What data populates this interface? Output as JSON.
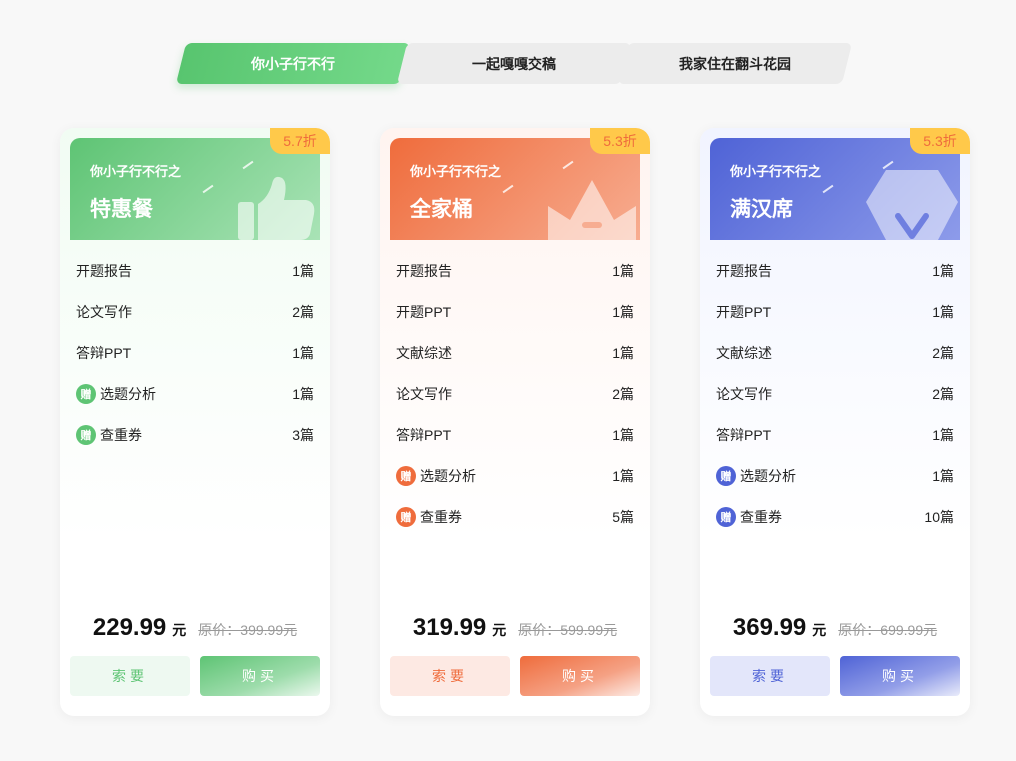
{
  "tabs": [
    {
      "label": "你小子行不行",
      "active": true
    },
    {
      "label": "一起嘎嘎交稿",
      "active": false
    },
    {
      "label": "我家住在翻斗花园",
      "active": false
    }
  ],
  "accents": {
    "green": "#5ec474",
    "orange": "#ef6c3c",
    "blue": "#4f63d6",
    "discount_badge": "#ffc94a"
  },
  "gift_label": "赠",
  "cards": [
    {
      "theme": "green",
      "discount": "5.7折",
      "subtitle": "你小子行不行之",
      "title": "特惠餐",
      "icon": "thumbs-up-icon",
      "items": [
        {
          "name": "开题报告",
          "count": "1篇",
          "gift": false
        },
        {
          "name": "论文写作",
          "count": "2篇",
          "gift": false
        },
        {
          "name": "答辩PPT",
          "count": "1篇",
          "gift": false
        },
        {
          "name": "选题分析",
          "count": "1篇",
          "gift": true
        },
        {
          "name": "查重券",
          "count": "3篇",
          "gift": true
        }
      ],
      "price": "229.99",
      "unit": "元",
      "original_price": "原价：399.99元",
      "ask_label": "索要",
      "buy_label": "购买"
    },
    {
      "theme": "orange",
      "discount": "5.3折",
      "subtitle": "你小子行不行之",
      "title": "全家桶",
      "icon": "crown-icon",
      "items": [
        {
          "name": "开题报告",
          "count": "1篇",
          "gift": false
        },
        {
          "name": "开题PPT",
          "count": "1篇",
          "gift": false
        },
        {
          "name": "文献综述",
          "count": "1篇",
          "gift": false
        },
        {
          "name": "论文写作",
          "count": "2篇",
          "gift": false
        },
        {
          "name": "答辩PPT",
          "count": "1篇",
          "gift": false
        },
        {
          "name": "选题分析",
          "count": "1篇",
          "gift": true
        },
        {
          "name": "查重券",
          "count": "5篇",
          "gift": true
        }
      ],
      "price": "319.99",
      "unit": "元",
      "original_price": "原价：599.99元",
      "ask_label": "索要",
      "buy_label": "购买"
    },
    {
      "theme": "blue",
      "discount": "5.3折",
      "subtitle": "你小子行不行之",
      "title": "满汉席",
      "icon": "diamond-icon",
      "items": [
        {
          "name": "开题报告",
          "count": "1篇",
          "gift": false
        },
        {
          "name": "开题PPT",
          "count": "1篇",
          "gift": false
        },
        {
          "name": "文献综述",
          "count": "2篇",
          "gift": false
        },
        {
          "name": "论文写作",
          "count": "2篇",
          "gift": false
        },
        {
          "name": "答辩PPT",
          "count": "1篇",
          "gift": false
        },
        {
          "name": "选题分析",
          "count": "1篇",
          "gift": true
        },
        {
          "name": "查重券",
          "count": "10篇",
          "gift": true
        }
      ],
      "price": "369.99",
      "unit": "元",
      "original_price": "原价：699.99元",
      "ask_label": "索要",
      "buy_label": "购买"
    }
  ]
}
